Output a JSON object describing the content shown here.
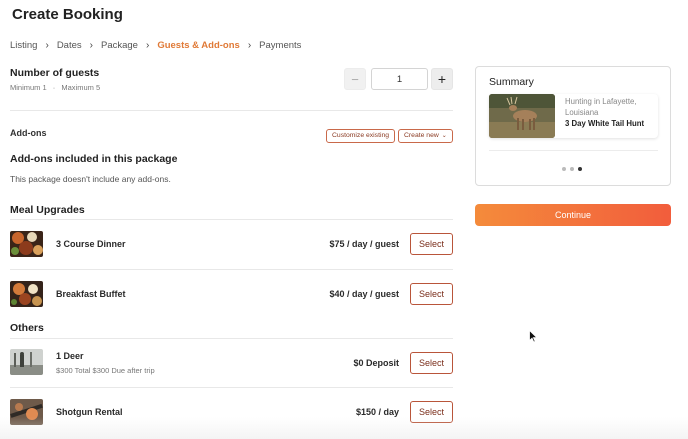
{
  "page": {
    "title": "Create Booking"
  },
  "breadcrumb": {
    "items": [
      {
        "label": "Listing"
      },
      {
        "label": "Dates"
      },
      {
        "label": "Package"
      },
      {
        "label": "Guests & Add-ons"
      },
      {
        "label": "Payments"
      }
    ],
    "active_index": 3
  },
  "guests": {
    "title": "Number of guests",
    "minimum": "Minimum 1",
    "separator": "·",
    "maximum": "Maximum 5",
    "value": "1",
    "decrement_symbol": "−",
    "increment_symbol": "+"
  },
  "addons": {
    "label": "Add-ons",
    "customize_label": "Customize existing",
    "create_label": "Create new",
    "included_title": "Add-ons included in this package",
    "included_text": "This package doesn't include any add-ons."
  },
  "meal_upgrades": {
    "title": "Meal Upgrades",
    "items": [
      {
        "name": "3 Course Dinner",
        "price": "$75 / day / guest",
        "select_label": "Select"
      },
      {
        "name": "Breakfast Buffet",
        "price": "$40 / day / guest",
        "select_label": "Select"
      }
    ]
  },
  "others": {
    "title": "Others",
    "items": [
      {
        "name": "1 Deer",
        "subtitle": "$300 Total $300 Due after trip",
        "price": "$0 Deposit",
        "select_label": "Select"
      },
      {
        "name": "Shotgun Rental",
        "price": "$150 / day",
        "select_label": "Select"
      }
    ]
  },
  "summary": {
    "title": "Summary",
    "location": "Hunting in Lafayette, Louisiana",
    "package_name": "3 Day White Tail Hunt",
    "carousel_count": 3,
    "carousel_active": 2
  },
  "continue_label": "Continue",
  "colors": {
    "accent": "#e07a37",
    "button_border": "#b9553a",
    "continue_start": "#f48b3b",
    "continue_end": "#f25d3c"
  },
  "icons": {
    "breadcrumb_separator": "chevron-right-icon",
    "create_dropdown": "chevron-down-icon",
    "cursor": "mouse-pointer-icon"
  }
}
